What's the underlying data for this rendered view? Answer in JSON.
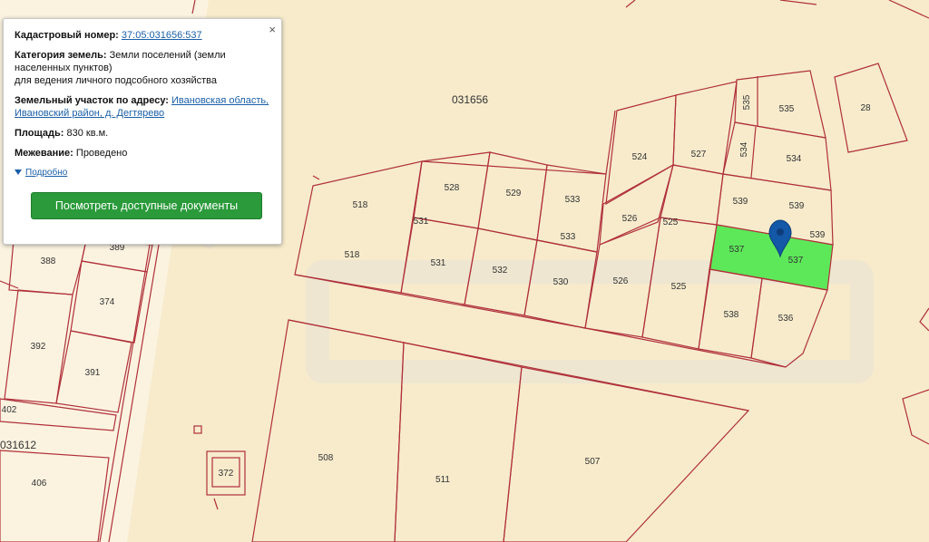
{
  "popup": {
    "close_label": "×",
    "cadastral_label": "Кадастровый номер:",
    "cadastral_value": "37:05:031656:537",
    "category_label": "Категория земель:",
    "category_value_1": "Земли поселений (земли",
    "category_value_2": "населенных пунктов)",
    "category_value_3": "для ведения личного подсобного хозяйства",
    "address_label": "Земельный участок по адресу:",
    "address_value_1": "Ивановская область,",
    "address_value_2": "Ивановский район, д. Дегтярево",
    "area_label": "Площадь:",
    "area_value": "830 кв.м.",
    "survey_label": "Межевание:",
    "survey_value": "Проведено",
    "more_label": "Подробно",
    "docs_button": "Посмотреть доступные документы"
  },
  "map": {
    "block_main": "031656",
    "block_left": "031612",
    "selected_color": "#5de85a",
    "boundary_color": "#b0303a",
    "marker_color": "#1458a8",
    "marker_icon": "map-pin-icon",
    "parcels": {
      "p28": "28",
      "p535a": "535",
      "p535b": "535",
      "p534a": "534",
      "p534b": "534",
      "p527": "527",
      "p524": "524",
      "p539a": "539",
      "p539b": "539",
      "p539c": "539",
      "p537a": "537",
      "p537b": "537",
      "p538": "538",
      "p536": "536",
      "p526a": "526",
      "p526b": "526",
      "p525a": "525",
      "p525b": "525",
      "p533a": "533",
      "p533b": "533",
      "p529": "529",
      "p528": "528",
      "p531a": "531",
      "p531b": "531",
      "p532": "532",
      "p530": "530",
      "p518a": "518",
      "p518b": "518",
      "p389": "389",
      "p388": "388",
      "p374": "374",
      "p392": "392",
      "p391": "391",
      "p402": "402",
      "p406": "406",
      "p372": "372",
      "p508": "508",
      "p511": "511",
      "p507": "507"
    }
  }
}
